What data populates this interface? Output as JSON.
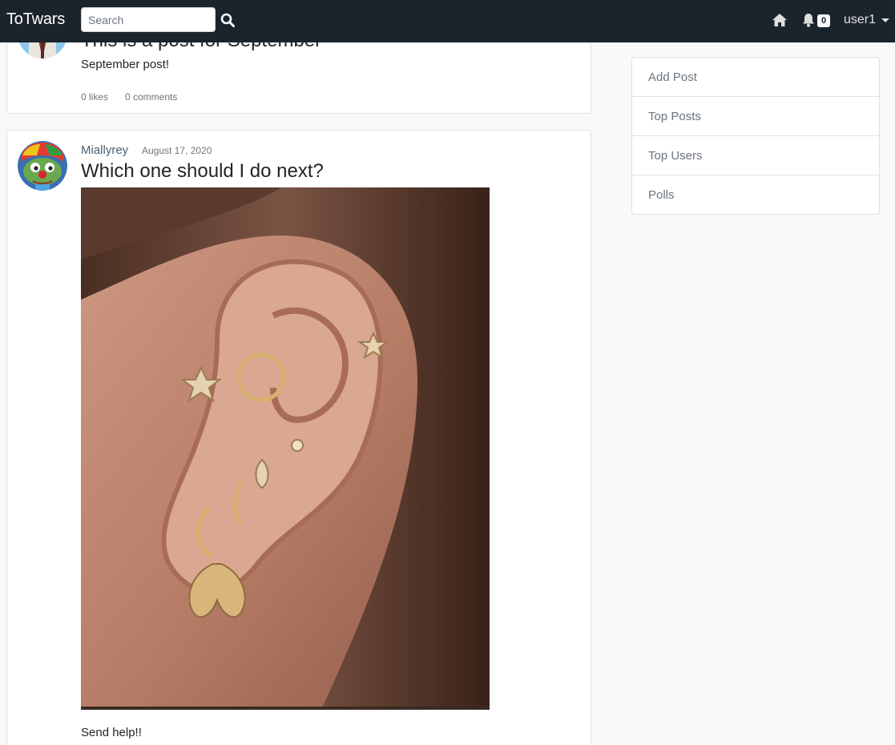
{
  "navbar": {
    "brand": "ToTwars",
    "search_placeholder": "Search",
    "search_icon": "search-icon",
    "home_icon": "home-icon",
    "bell_icon": "bell-icon",
    "notification_count": "0",
    "username": "user1"
  },
  "posts": [
    {
      "title_partial": "This is a post for September",
      "body": "September post!",
      "likes": "0 likes",
      "comments": "0 comments"
    },
    {
      "author": "Miallyrey",
      "date": "August 17, 2020",
      "title": "Which one should I do next?",
      "body": "Send help!!"
    }
  ],
  "sidebar": {
    "items": [
      {
        "label": "Add Post"
      },
      {
        "label": "Top Posts"
      },
      {
        "label": "Top Users"
      },
      {
        "label": "Polls"
      }
    ]
  },
  "colors": {
    "navbar": "#1b242c",
    "background": "#f8f9fa",
    "muted": "#6c757d",
    "author": "#495e72"
  }
}
